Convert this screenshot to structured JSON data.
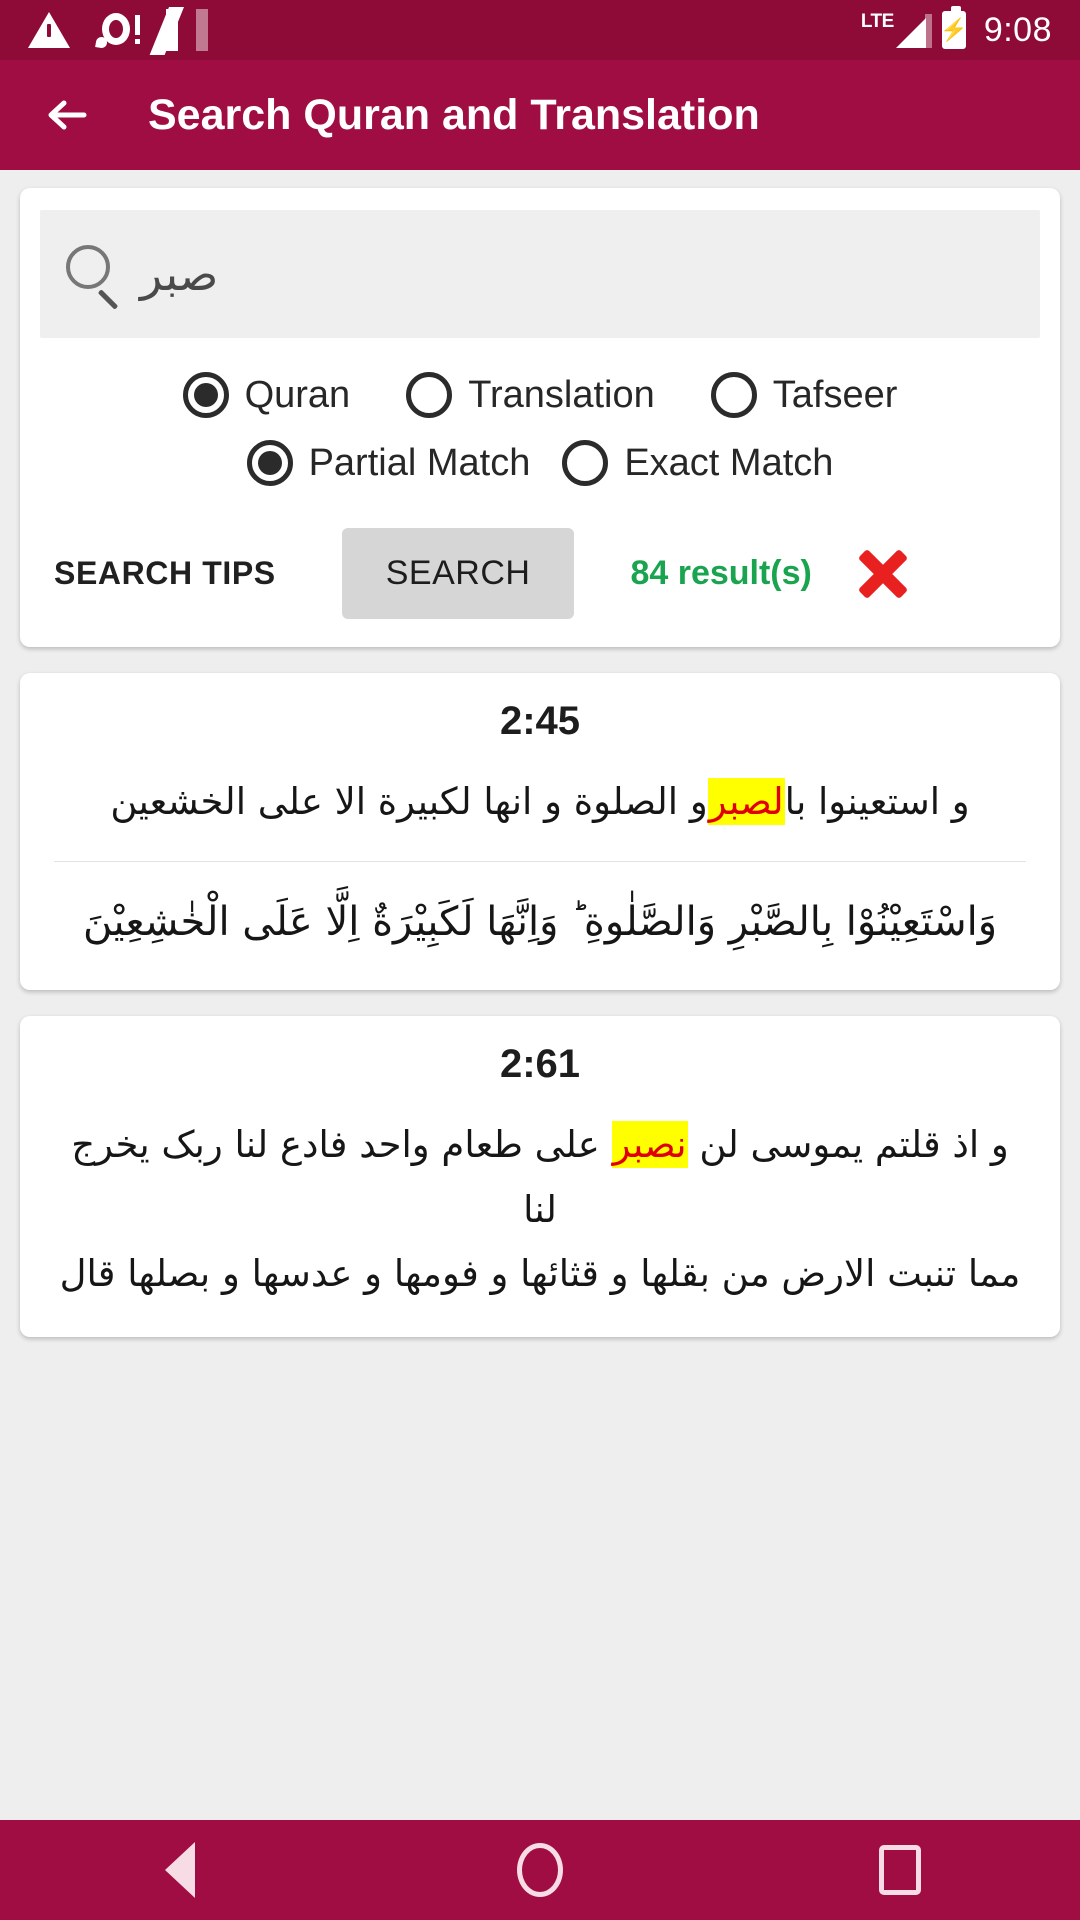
{
  "status_bar": {
    "icons": [
      "warning-icon",
      "location-alert-icon",
      "nougat-icon"
    ],
    "network_label": "LTE",
    "time": "9:08"
  },
  "app_bar": {
    "back_label": "back-arrow-icon",
    "title": "Search Quran and Translation"
  },
  "search_card": {
    "input": {
      "value": "صبر",
      "placeholder": "",
      "icon": "search-icon"
    },
    "scope_options": [
      {
        "label": "Quran",
        "selected": true
      },
      {
        "label": "Translation",
        "selected": false
      },
      {
        "label": "Tafseer",
        "selected": false
      }
    ],
    "match_options": [
      {
        "label": "Partial Match",
        "selected": true
      },
      {
        "label": "Exact Match",
        "selected": false
      }
    ],
    "search_tips_label": "SEARCH TIPS",
    "search_button_label": "SEARCH",
    "result_count_label": "84 result(s)",
    "result_count_color": "#1aa44f",
    "clear_icon": "close-x-icon",
    "clear_icon_color": "#e82020"
  },
  "results": [
    {
      "reference": "2:45",
      "plain_arabic_before": "و استعينوا با",
      "plain_arabic_highlight": "لصبر",
      "plain_arabic_after": "و الصلوة و انها لكبيرة الا على الخشعين",
      "script_arabic": "وَاسْتَعِيْنُوْا بِالصَّبْرِ وَالصَّلٰوةِ ؕ وَاِنَّهَا لَكَبِيْرَةٌ اِلَّا عَلَى الْخٰشِعِيْنَ"
    },
    {
      "reference": "2:61",
      "plain_arabic_before": "و اذ قلتم يموسى لن ",
      "plain_arabic_highlight": "نصبر",
      "plain_arabic_after": " على طعام واحد فادع لنا ربک يخرج لنا",
      "script_arabic": "مما تنبت الارض من بقلها و قثائها و فومها و عدسها و بصلها قال"
    }
  ],
  "nav_bar": {
    "buttons": [
      "back-triangle-icon",
      "home-circle-icon",
      "recents-square-icon"
    ]
  },
  "theme": {
    "status_bar_color": "#8e0b38",
    "app_bar_color": "#a00d42",
    "page_background": "#eeeeee",
    "card_background": "#ffffff",
    "highlight_background": "#ffff00",
    "highlight_text": "#e00000"
  }
}
